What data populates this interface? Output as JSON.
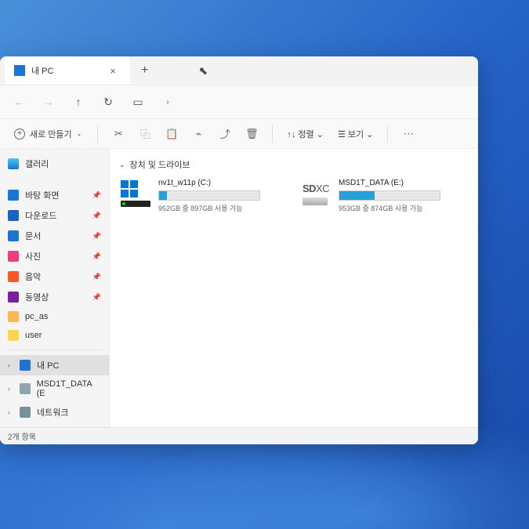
{
  "tab": {
    "title": "내 PC"
  },
  "toolbar": {
    "new_label": "새로 만들기",
    "sort_label": "정렬",
    "view_label": "보기"
  },
  "sidebar": {
    "gallery": "갤러리",
    "desktop": "바탕 화면",
    "downloads": "다운로드",
    "documents": "문서",
    "pictures": "사진",
    "music": "음악",
    "videos": "동영상",
    "pc_as": "pc_as",
    "user": "user",
    "this_pc": "내 PC",
    "msd1t": "MSD1T_DATA (E",
    "network": "네트워크"
  },
  "content": {
    "section": "장치 및 드라이브",
    "drives": [
      {
        "name": "nv1t_w11p (C:)",
        "status": "952GB 중 897GB 사용 가능",
        "fill": 8
      },
      {
        "name": "MSD1T_DATA (E:)",
        "status": "953GB 중 874GB 사용 가능",
        "fill": 35
      }
    ]
  },
  "statusbar": {
    "count": "2개 항목"
  }
}
